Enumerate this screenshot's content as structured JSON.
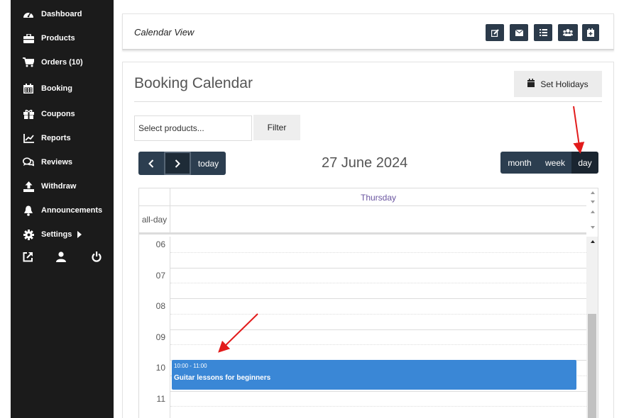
{
  "sidebar": {
    "items": [
      {
        "label": "Dashboard",
        "icon": "dashboard-icon"
      },
      {
        "label": "Products",
        "icon": "briefcase-icon"
      },
      {
        "label": "Orders (10)",
        "icon": "cart-icon"
      },
      {
        "label": "Booking",
        "icon": "calendar-icon"
      },
      {
        "label": "Coupons",
        "icon": "gift-icon"
      },
      {
        "label": "Reports",
        "icon": "chart-icon"
      },
      {
        "label": "Reviews",
        "icon": "comments-icon"
      },
      {
        "label": "Withdraw",
        "icon": "upload-icon"
      },
      {
        "label": "Announcements",
        "icon": "bell-icon"
      },
      {
        "label": "Settings",
        "icon": "gear-icon"
      }
    ],
    "bottom_icons": [
      "external-link-icon",
      "user-icon",
      "power-icon"
    ]
  },
  "header": {
    "title": "Calendar View",
    "buttons": [
      "edit-icon",
      "envelope-icon",
      "list-icon",
      "users-icon",
      "calendar-add-icon"
    ]
  },
  "main": {
    "title": "Booking Calendar",
    "set_holidays_label": "Set Holidays",
    "product_placeholder": "Select products...",
    "filter_label": "Filter"
  },
  "calendar": {
    "today_label": "today",
    "date_title": "27 June 2024",
    "views": {
      "month": "month",
      "week": "week",
      "day": "day"
    },
    "active_view": "day",
    "day_name": "Thursday",
    "all_day_label": "all-day",
    "hours": [
      "06",
      "07",
      "08",
      "09",
      "10",
      "11"
    ],
    "event": {
      "time": "10:00 - 11:00",
      "title": "Guitar lessons for beginners",
      "color": "#3a87d6"
    }
  },
  "colors": {
    "sidebar_bg": "#1b1b1b",
    "nav_button": "#2c3e50",
    "event": "#3a87d6",
    "annotation": "#e21b1b",
    "day_header": "#6a55a0"
  }
}
